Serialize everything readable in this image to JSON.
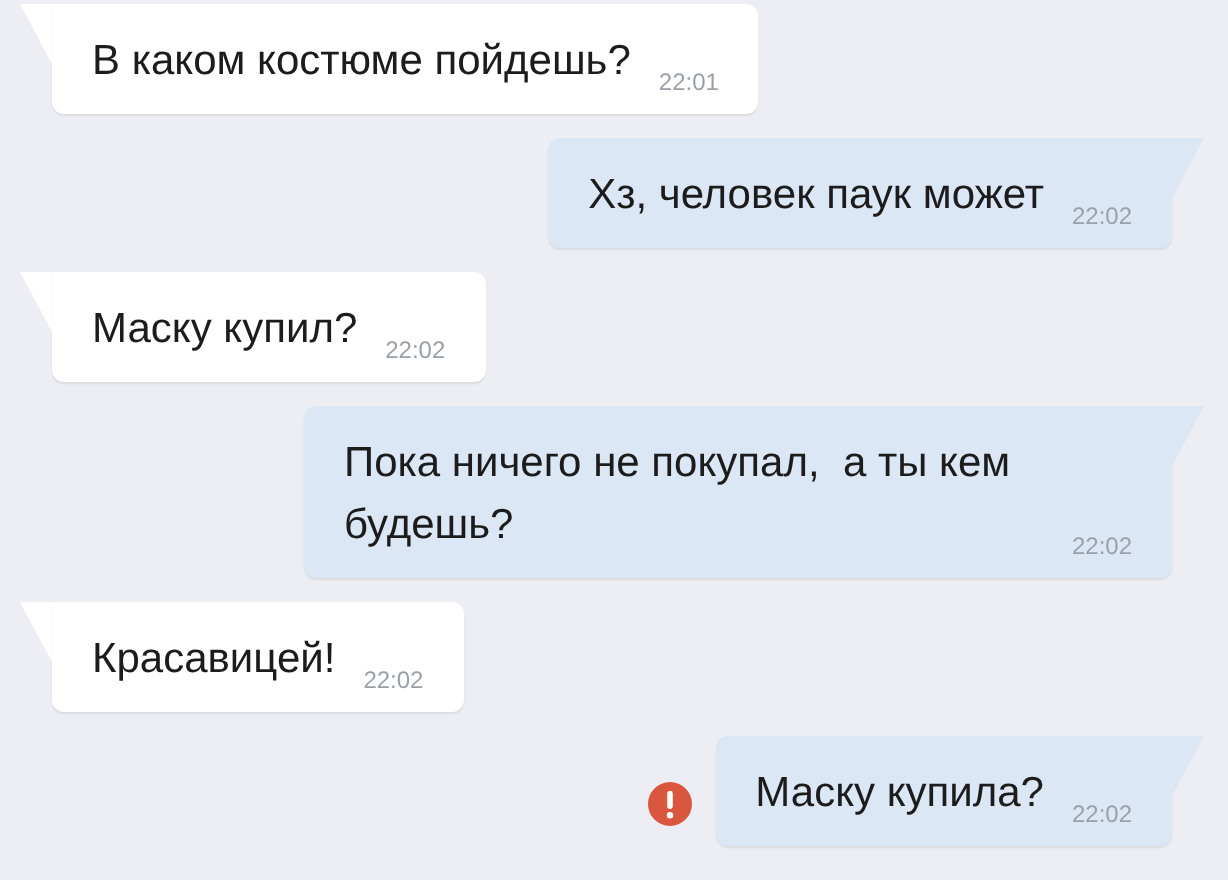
{
  "messages": [
    {
      "kind": "incoming",
      "text": "В каком костюме пойдешь?",
      "time": "22:01",
      "failed": false
    },
    {
      "kind": "outgoing",
      "text": "Хз, человек паук может",
      "time": "22:02",
      "failed": false
    },
    {
      "kind": "incoming",
      "text": "Маску купил?",
      "time": "22:02",
      "failed": false
    },
    {
      "kind": "outgoing",
      "text": "Пока ничего не покупал,  а ты кем будешь?",
      "time": "22:02",
      "failed": false
    },
    {
      "kind": "incoming",
      "text": "Красавицей!",
      "time": "22:02",
      "failed": false
    },
    {
      "kind": "outgoing",
      "text": "Маску купила?",
      "time": "22:02",
      "failed": true
    }
  ]
}
